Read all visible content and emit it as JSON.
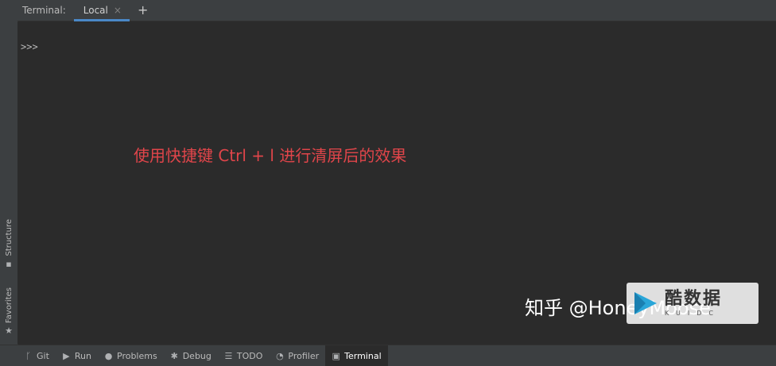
{
  "header": {
    "title": "Terminal:",
    "tabs": [
      {
        "label": "Local",
        "close": "×"
      }
    ],
    "add": "+"
  },
  "terminal": {
    "prompt": ">>>",
    "annotation": "使用快捷键 Ctrl + l 进行清屏后的效果"
  },
  "left_strip": {
    "structure": "Structure",
    "favorites": "Favorites"
  },
  "bottom_bar": {
    "items": [
      {
        "label": "Git",
        "icon": "git-branch-icon"
      },
      {
        "label": "Run",
        "icon": "play-icon"
      },
      {
        "label": "Problems",
        "icon": "info-icon"
      },
      {
        "label": "Debug",
        "icon": "bug-icon"
      },
      {
        "label": "TODO",
        "icon": "list-icon"
      },
      {
        "label": "Profiler",
        "icon": "profiler-icon"
      },
      {
        "label": "Terminal",
        "icon": "terminal-icon"
      }
    ]
  },
  "watermark": {
    "zhihu": "知乎 @HoneyMoose",
    "logo_main": "酷数据",
    "logo_sub": "KUIDC"
  },
  "colors": {
    "background": "#2b2b2b",
    "toolbar": "#3c3f41",
    "accent": "#4a88c7",
    "annotation": "#e0454a"
  }
}
